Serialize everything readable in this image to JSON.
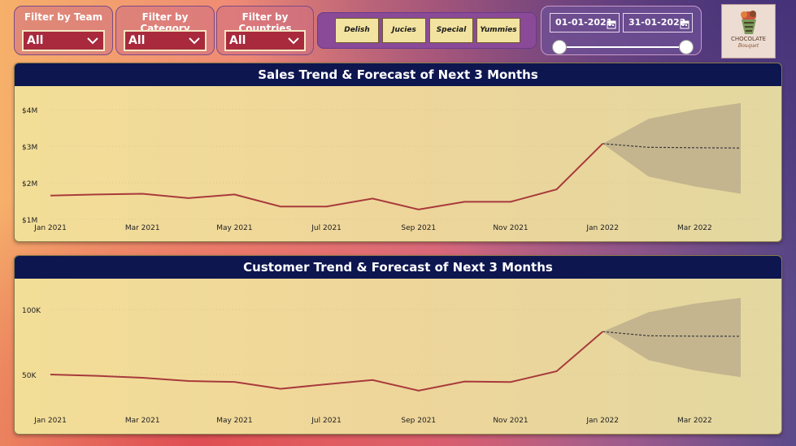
{
  "filters": [
    {
      "title": "Filter by Team",
      "value": "All"
    },
    {
      "title": "Filter by Category",
      "value": "All"
    },
    {
      "title": "Filter by Countries",
      "value": "All"
    }
  ],
  "category_buttons": [
    "Delish",
    "Jucies",
    "Special",
    "Yummies"
  ],
  "date_slicer": {
    "start": "01-01-2021",
    "end": "31-01-2022"
  },
  "logo": {
    "brand": "CHOCOLATE",
    "tagline": "Bouquet"
  },
  "colors": {
    "line": "#a83a3c",
    "forecast_band": "#b8a98a",
    "title_bar": "#0e1650"
  },
  "chart_data": [
    {
      "type": "line",
      "title": "Sales Trend & Forecast of Next 3 Months",
      "x": [
        "Jan 2021",
        "Feb 2021",
        "Mar 2021",
        "Apr 2021",
        "May 2021",
        "Jun 2021",
        "Jul 2021",
        "Aug 2021",
        "Sep 2021",
        "Oct 2021",
        "Nov 2021",
        "Dec 2021",
        "Jan 2022"
      ],
      "x_ticks": [
        "Jan 2021",
        "Mar 2021",
        "May 2021",
        "Jul 2021",
        "Sep 2021",
        "Nov 2021",
        "Jan 2022",
        "Mar 2022"
      ],
      "values": [
        1.65,
        1.68,
        1.7,
        1.58,
        1.68,
        1.35,
        1.35,
        1.57,
        1.27,
        1.48,
        1.48,
        1.82,
        3.07
      ],
      "forecast": {
        "x": [
          "Jan 2022",
          "Feb 2022",
          "Mar 2022",
          "Apr 2022"
        ],
        "values": [
          3.07,
          2.97,
          2.96,
          2.95
        ],
        "upper": [
          3.07,
          3.75,
          4.0,
          4.18
        ],
        "lower": [
          3.07,
          2.17,
          1.9,
          1.7
        ]
      },
      "y_ticks": [
        "$1M",
        "$2M",
        "$3M",
        "$4M"
      ],
      "ylim": [
        1,
        4
      ],
      "grid": true
    },
    {
      "type": "line",
      "title": "Customer Trend & Forecast of Next 3 Months",
      "x": [
        "Jan 2021",
        "Feb 2021",
        "Mar 2021",
        "Apr 2021",
        "May 2021",
        "Jun 2021",
        "Jul 2021",
        "Aug 2021",
        "Sep 2021",
        "Oct 2021",
        "Nov 2021",
        "Dec 2021",
        "Jan 2022"
      ],
      "x_ticks": [
        "Jan 2021",
        "Mar 2021",
        "May 2021",
        "Jul 2021",
        "Sep 2021",
        "Nov 2021",
        "Jan 2022",
        "Mar 2022"
      ],
      "values": [
        50000,
        49000,
        47500,
        45000,
        44300,
        39000,
        42500,
        45800,
        37600,
        44600,
        44200,
        52500,
        83000
      ],
      "forecast": {
        "x": [
          "Jan 2022",
          "Feb 2022",
          "Mar 2022",
          "Apr 2022"
        ],
        "values": [
          83000,
          79800,
          79500,
          79400
        ],
        "upper": [
          83000,
          98000,
          104500,
          109000
        ],
        "lower": [
          83000,
          61000,
          53200,
          48000
        ]
      },
      "y_ticks": [
        "50K",
        "100K"
      ],
      "ylim": [
        50000,
        100000
      ],
      "grid": true
    }
  ]
}
